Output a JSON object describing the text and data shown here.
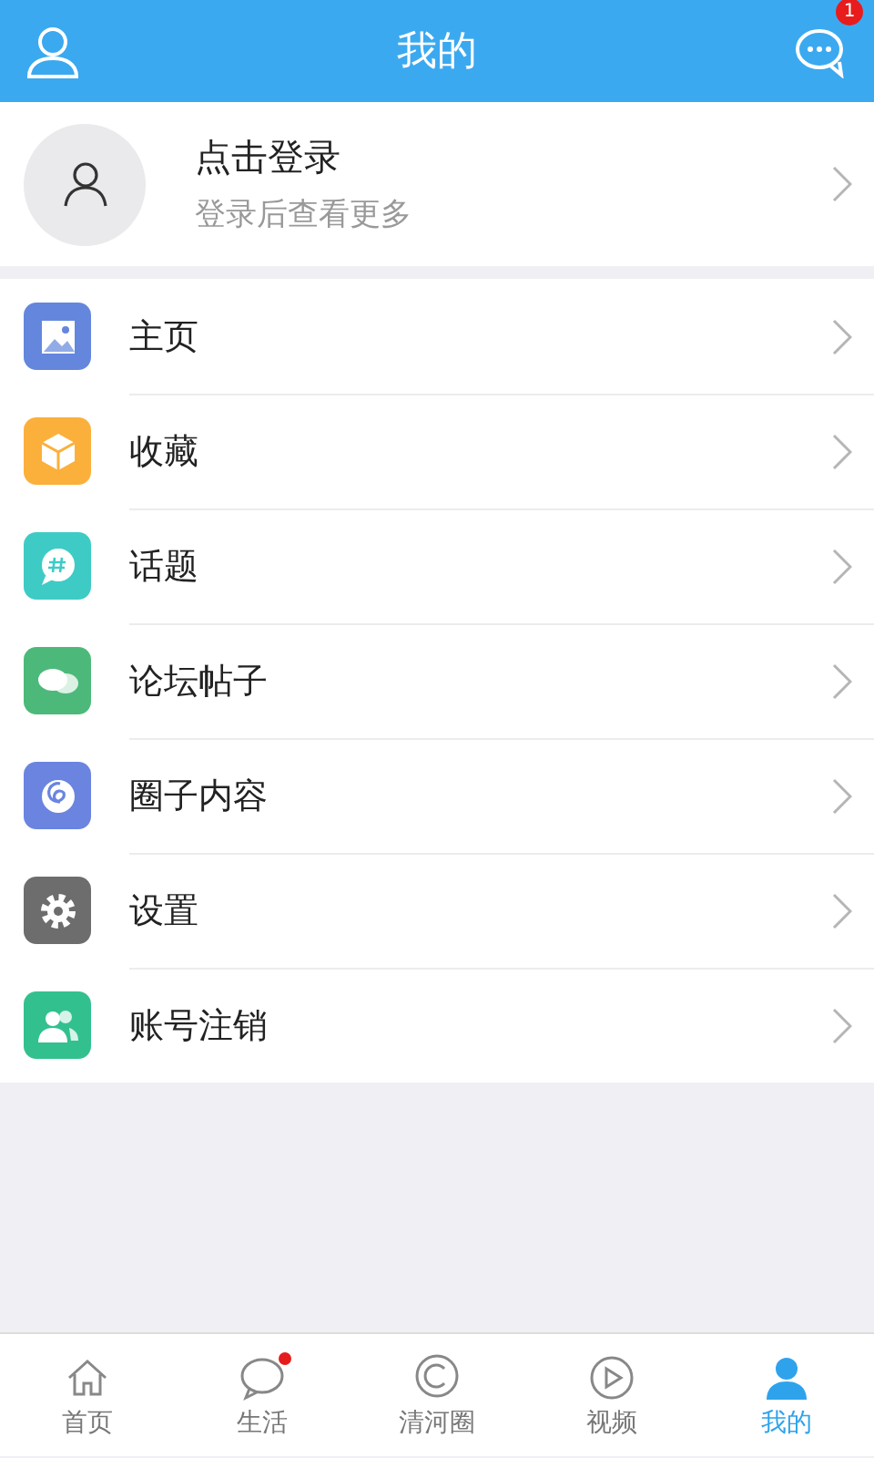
{
  "header": {
    "title": "我的",
    "message_badge": "1"
  },
  "profile": {
    "name": "点击登录",
    "hint": "登录后查看更多"
  },
  "menu": [
    {
      "label": "主页",
      "color": "#6487dd"
    },
    {
      "label": "收藏",
      "color": "#fbb03b"
    },
    {
      "label": "话题",
      "color": "#3ecbc6"
    },
    {
      "label": "论坛帖子",
      "color": "#4cb97a"
    },
    {
      "label": "圈子内容",
      "color": "#6a84e0"
    },
    {
      "label": "设置",
      "color": "#6d6d6d"
    },
    {
      "label": "账号注销",
      "color": "#33c08f"
    }
  ],
  "tabs": [
    {
      "label": "首页",
      "selected": false,
      "dot": false
    },
    {
      "label": "生活",
      "selected": false,
      "dot": true
    },
    {
      "label": "清河圈",
      "selected": false,
      "dot": false
    },
    {
      "label": "视频",
      "selected": false,
      "dot": false
    },
    {
      "label": "我的",
      "selected": true,
      "dot": false
    }
  ]
}
